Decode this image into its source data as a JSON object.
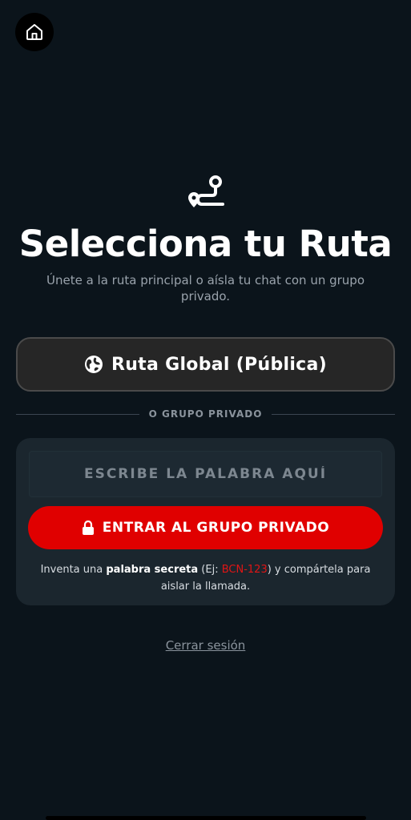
{
  "header": {
    "home_icon": "home-icon"
  },
  "hero": {
    "icon": "route-icon",
    "title": "Selecciona tu Ruta",
    "subtitle": "Únete a la ruta principal o aísla tu chat con un grupo privado."
  },
  "global_route": {
    "icon": "globe-icon",
    "label": "Ruta Global (Pública)"
  },
  "divider": {
    "label": "O GRUPO PRIVADO"
  },
  "private_group": {
    "input_placeholder": "ESCRIBE LA PALABRA AQUÍ",
    "input_value": "",
    "enter_icon": "lock-icon",
    "enter_label": "ENTRAR AL GRUPO PRIVADO",
    "hint": {
      "part1": "Inventa una ",
      "bold": "palabra secreta",
      "part2": " (Ej: ",
      "example": "BCN-123",
      "part3": ") y compártela para aislar la llamada."
    }
  },
  "footer": {
    "logout_label": "Cerrar sesión"
  },
  "colors": {
    "background": "#0b141b",
    "accent_red": "#e00000",
    "card": "#1b262e",
    "global_button": "#262626"
  }
}
